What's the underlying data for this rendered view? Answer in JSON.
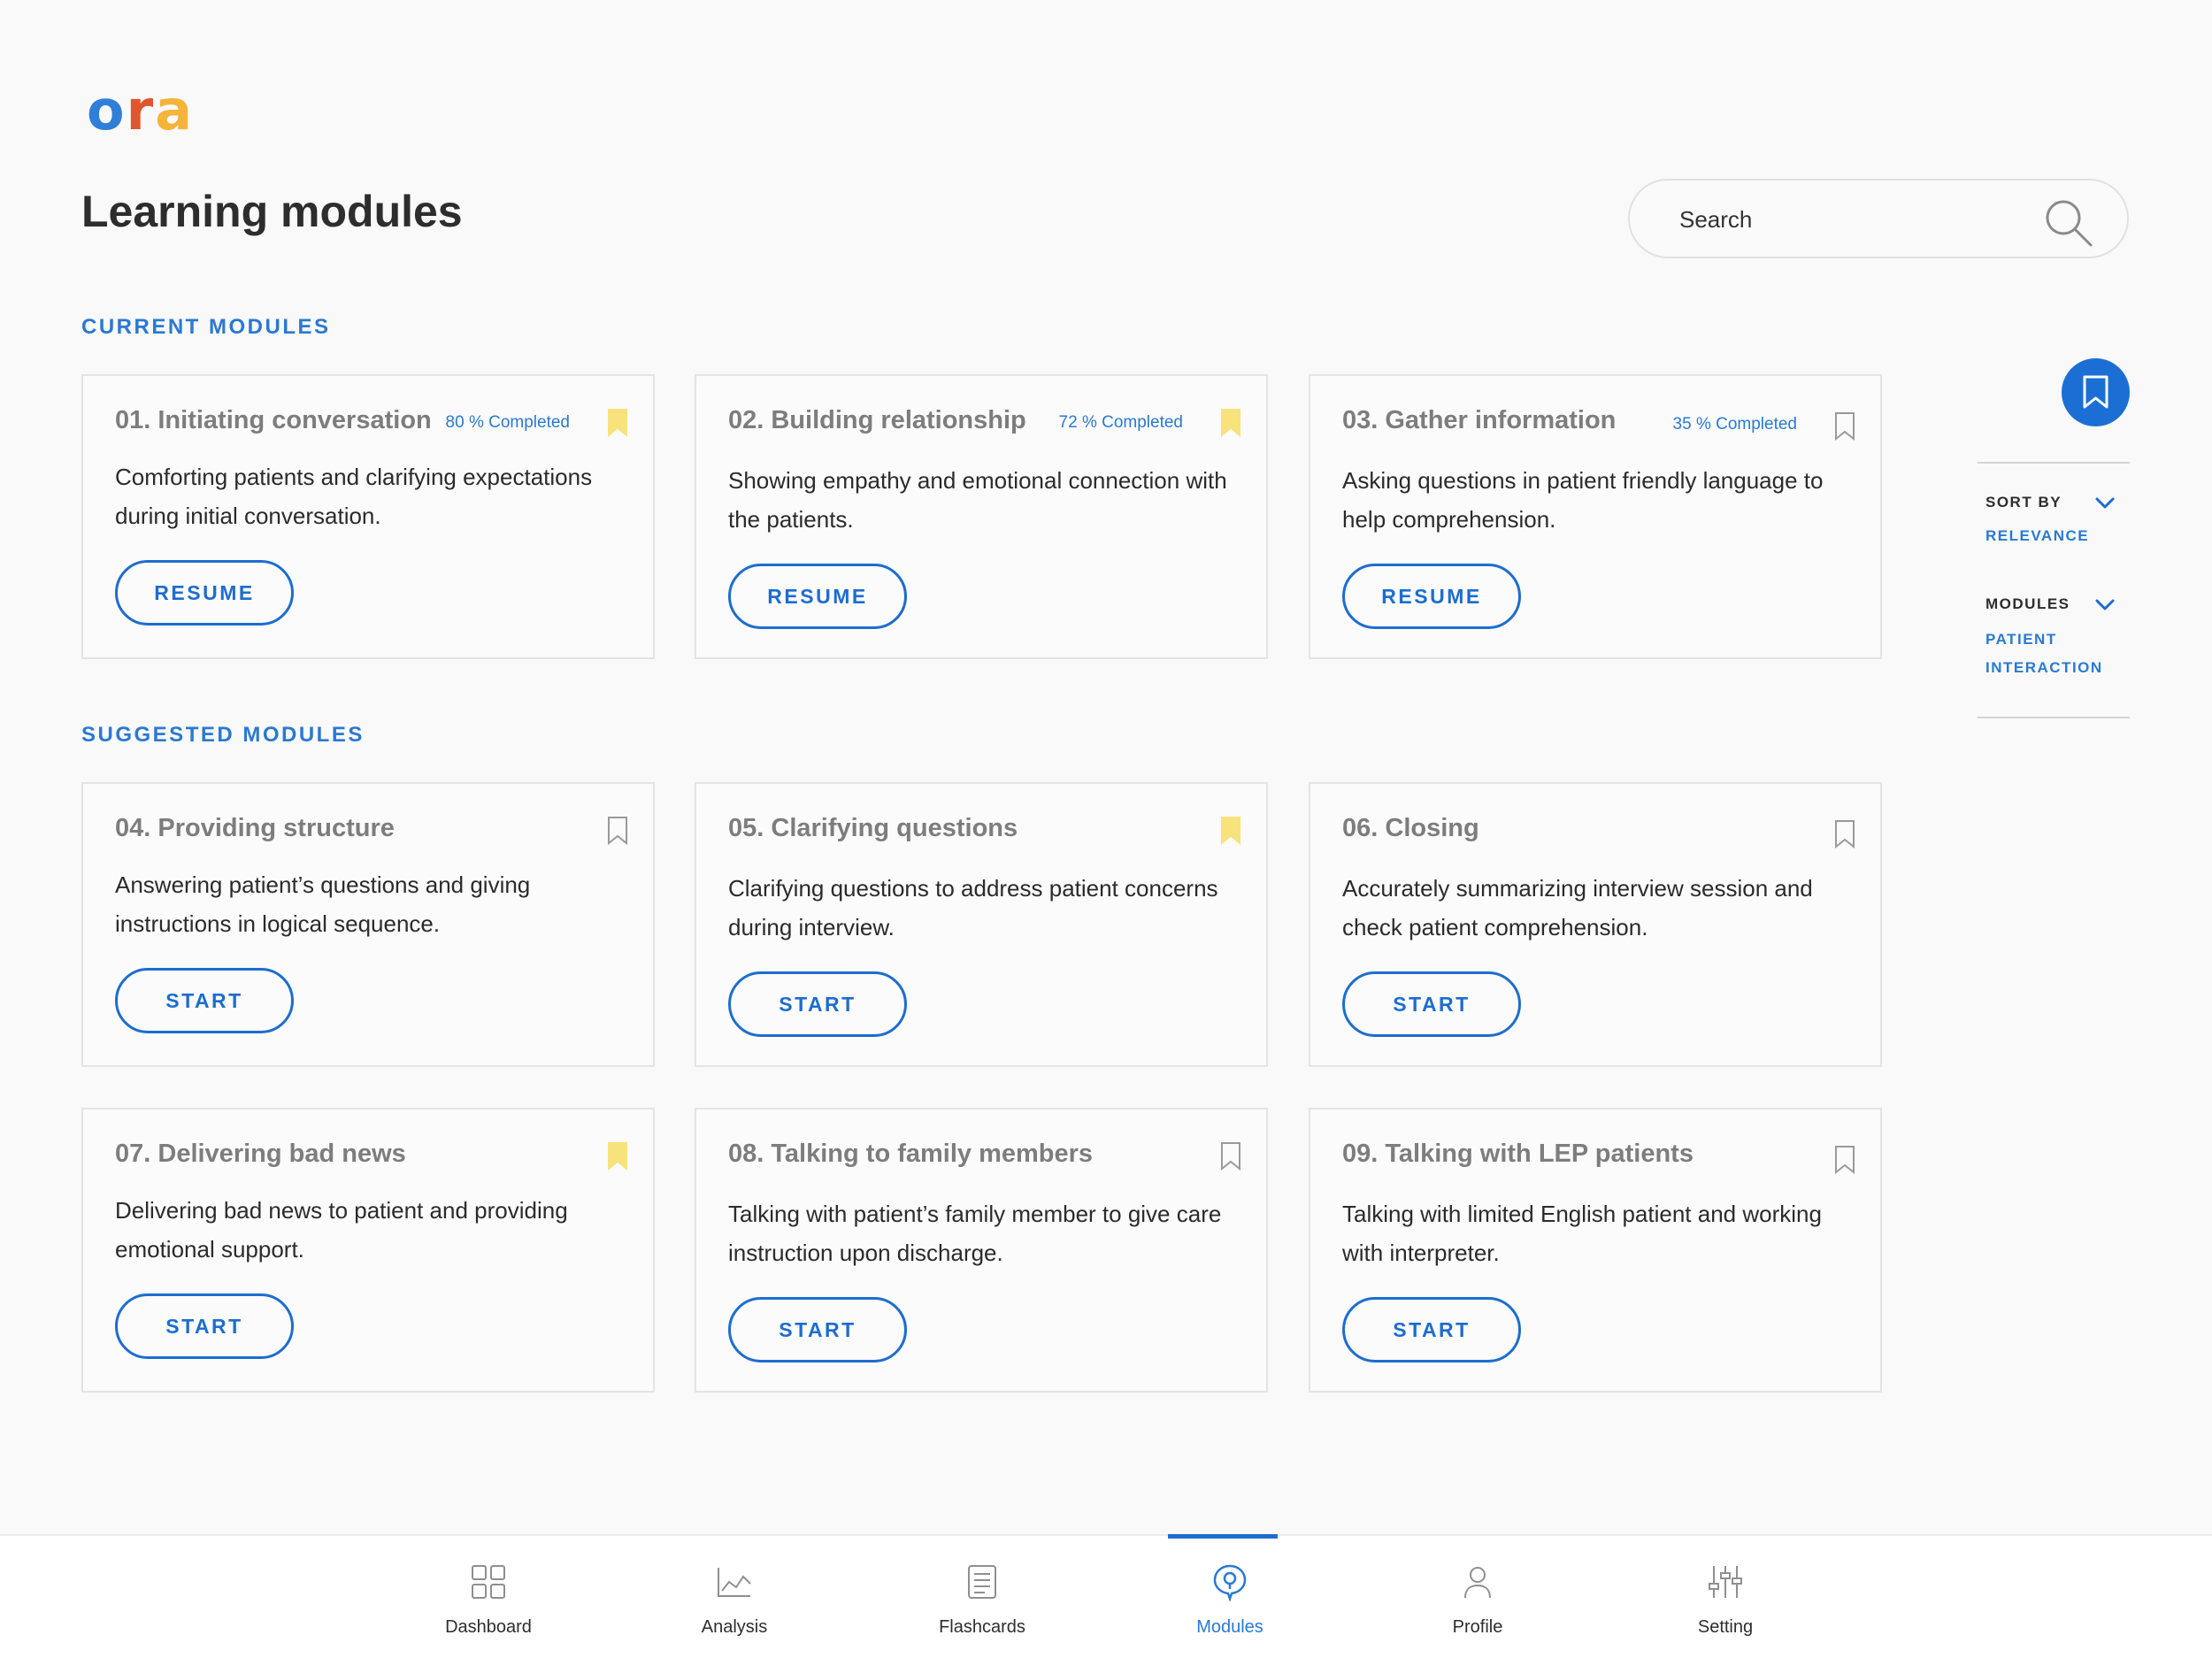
{
  "brand": {
    "logo_o": "o",
    "logo_r": "r",
    "logo_a": "a"
  },
  "page_title": "Learning modules",
  "search": {
    "placeholder": "Search",
    "value": ""
  },
  "sections": {
    "current": "CURRENT MODULES",
    "suggested": "SUGGESTED MODULES"
  },
  "current_modules": [
    {
      "title": "01. Initiating conversation",
      "progress": "80 % Completed",
      "bookmarked": true,
      "description": "Comforting patients and clarifying expectations during initial conversation.",
      "button": "RESUME"
    },
    {
      "title": "02. Building relationship",
      "progress": "72 % Completed",
      "bookmarked": true,
      "description": "Showing empathy and emotional connection with the patients.",
      "button": "RESUME"
    },
    {
      "title": "03. Gather information",
      "progress": "35 % Completed",
      "bookmarked": false,
      "description": "Asking questions in patient friendly language to help comprehension.",
      "button": "RESUME"
    }
  ],
  "suggested_modules": [
    {
      "title": "04. Providing structure",
      "bookmarked": false,
      "description": "Answering patient’s questions and giving instructions in logical sequence.",
      "button": "START"
    },
    {
      "title": "05. Clarifying questions",
      "bookmarked": true,
      "description": "Clarifying questions to address patient concerns during interview.",
      "button": "START"
    },
    {
      "title": "06. Closing",
      "bookmarked": false,
      "description": "Accurately summarizing interview session and check patient comprehension.",
      "button": "START"
    },
    {
      "title": "07. Delivering bad news",
      "bookmarked": true,
      "description": "Delivering bad news to patient and providing emotional support.",
      "button": "START"
    },
    {
      "title": "08. Talking to family members",
      "bookmarked": false,
      "description": "Talking with patient’s family member to give care instruction upon discharge.",
      "button": "START"
    },
    {
      "title": "09. Talking with LEP patients",
      "bookmarked": false,
      "description": "Talking with limited English patient and working with interpreter.",
      "button": "START"
    }
  ],
  "filters": {
    "sort_by": {
      "label": "SORT BY",
      "value": "RELEVANCE"
    },
    "modules": {
      "label": "MODULES",
      "value_line1": "PATIENT",
      "value_line2": "INTERACTION"
    }
  },
  "nav": [
    {
      "label": "Dashboard",
      "icon": "grid-icon",
      "active": false
    },
    {
      "label": "Analysis",
      "icon": "line-chart-icon",
      "active": false
    },
    {
      "label": "Flashcards",
      "icon": "flashcards-icon",
      "active": false
    },
    {
      "label": "Modules",
      "icon": "modules-icon",
      "active": true
    },
    {
      "label": "Profile",
      "icon": "person-icon",
      "active": false
    },
    {
      "label": "Setting",
      "icon": "sliders-icon",
      "active": false
    }
  ],
  "colors": {
    "accent": "#1d6dcf",
    "bookmark_active": "#f8e27c",
    "bookmark_inactive": "#9a9a9a",
    "background": "#f9f9f9"
  }
}
